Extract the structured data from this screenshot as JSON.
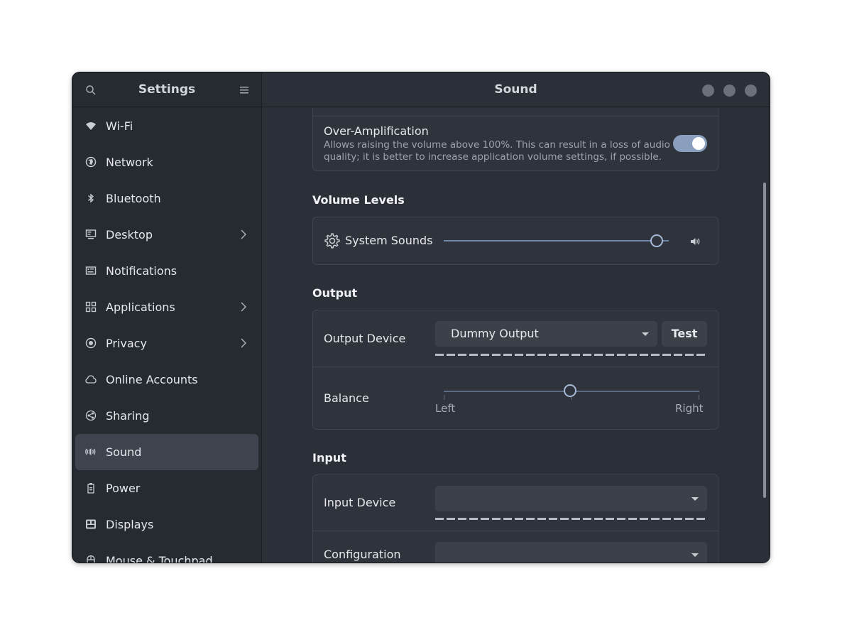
{
  "sidebar": {
    "title": "Settings",
    "items": [
      {
        "label": "Wi-Fi",
        "icon": "wifi-icon",
        "chevron": false
      },
      {
        "label": "Network",
        "icon": "network-icon",
        "chevron": false
      },
      {
        "label": "Bluetooth",
        "icon": "bluetooth-icon",
        "chevron": false
      },
      {
        "label": "Desktop",
        "icon": "desktop-icon",
        "chevron": true
      },
      {
        "label": "Notifications",
        "icon": "notifications-icon",
        "chevron": false
      },
      {
        "label": "Applications",
        "icon": "applications-icon",
        "chevron": true
      },
      {
        "label": "Privacy",
        "icon": "privacy-icon",
        "chevron": true
      },
      {
        "label": "Online Accounts",
        "icon": "cloud-icon",
        "chevron": false
      },
      {
        "label": "Sharing",
        "icon": "share-icon",
        "chevron": false
      },
      {
        "label": "Sound",
        "icon": "speaker-icon",
        "chevron": false
      },
      {
        "label": "Power",
        "icon": "power-icon",
        "chevron": false
      },
      {
        "label": "Displays",
        "icon": "displays-icon",
        "chevron": false
      },
      {
        "label": "Mouse & Touchpad",
        "icon": "mouse-icon",
        "chevron": false
      }
    ],
    "selected": "Sound"
  },
  "main": {
    "title": "Sound",
    "over_amplification": {
      "title": "Over-Amplification",
      "description_line1": "Allows raising the volume above 100%. This can result in a loss of audio",
      "description_line2": "quality; it is better to increase application volume settings, if possible.",
      "enabled": true
    },
    "volume_levels": {
      "section_title": "Volume Levels",
      "system_sounds_label": "System Sounds",
      "system_sounds_level": 0.95
    },
    "output": {
      "section_title": "Output",
      "device_label": "Output Device",
      "device_value": "Dummy Output",
      "test_label": "Test",
      "balance_label": "Balance",
      "balance_left": "Left",
      "balance_right": "Right",
      "balance_level": 0.5
    },
    "input": {
      "section_title": "Input",
      "device_label": "Input Device",
      "device_value": "",
      "configuration_label": "Configuration",
      "configuration_value": ""
    }
  },
  "colors": {
    "window_bg": "#2b2f37",
    "sidebar_bg": "#262a31",
    "accent": "#8a9fbe",
    "selected_item": "#3e434d"
  }
}
